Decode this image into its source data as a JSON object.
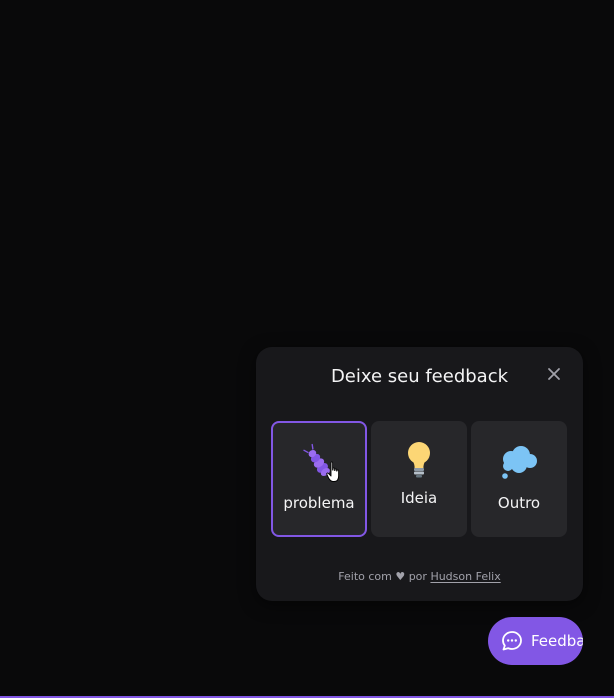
{
  "widget": {
    "title": "Deixe seu feedback",
    "close_icon": "close-icon",
    "options": [
      {
        "label": "problema",
        "icon": "bug-icon",
        "selected": true
      },
      {
        "label": "Ideia",
        "icon": "lightbulb-icon",
        "selected": false
      },
      {
        "label": "Outro",
        "icon": "thought-cloud-icon",
        "selected": false
      }
    ],
    "footer": {
      "prefix": "Feito com ♥ por",
      "author": "Hudson Felix"
    }
  },
  "fab": {
    "label": "Feedback",
    "icon": "chat-bubble-icon"
  },
  "colors": {
    "background": "#09090a",
    "surface": "#18181b",
    "option_bg": "#27272a",
    "accent": "#8257e5",
    "text": "#f4f4f5",
    "muted": "#a1a1aa"
  }
}
